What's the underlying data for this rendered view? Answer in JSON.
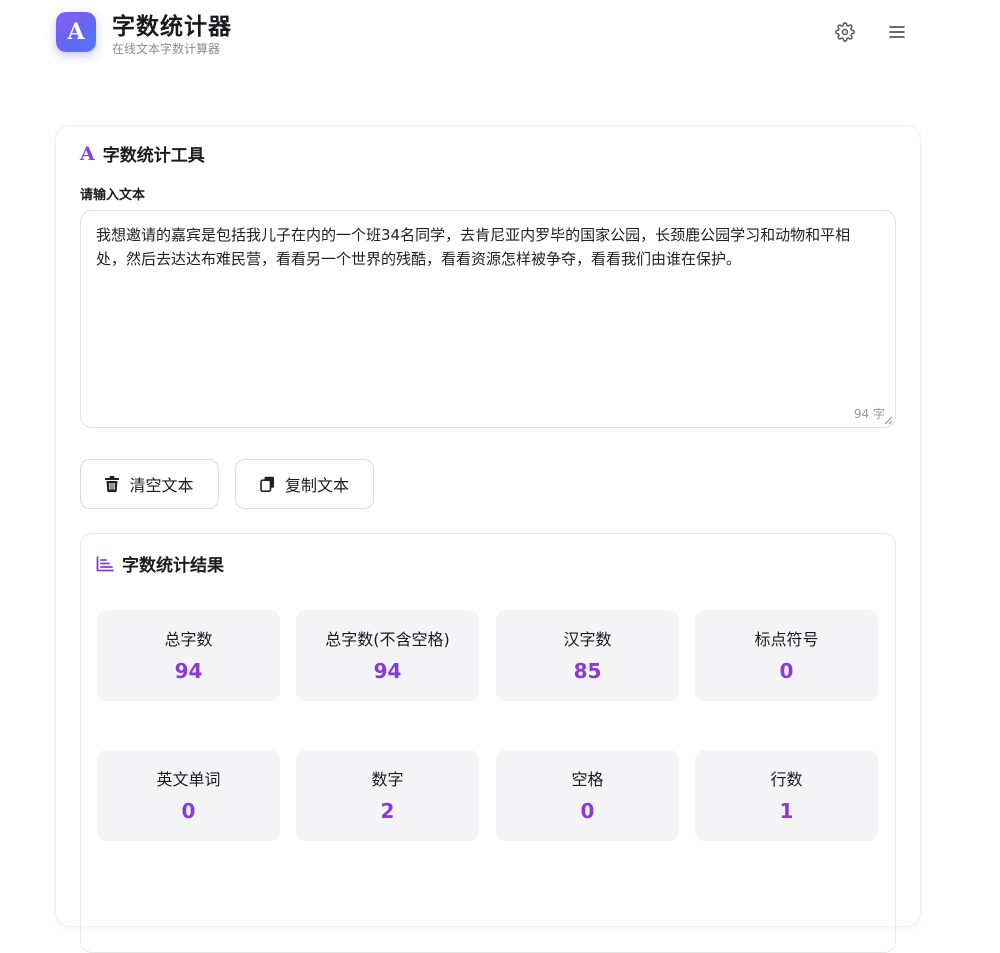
{
  "header": {
    "logo_letter": "A",
    "title": "字数统计器",
    "subtitle": "在线文本字数计算器",
    "settings_icon": "gear-icon",
    "menu_icon": "hamburger-menu-icon"
  },
  "tool": {
    "title": "字数统计工具",
    "title_icon": "letter-a-icon",
    "input_label": "请输入文本",
    "text_value": "我想邀请的嘉宾是包括我儿子在内的一个班34名同学，去肯尼亚内罗毕的国家公园，长颈鹿公园学习和动物和平相处，然后去达达布难民营，看看另一个世界的残酷，看看资源怎样被争夺，看看我们由谁在保护。",
    "char_count": "94 字",
    "clear_button": "清空文本",
    "copy_button": "复制文本"
  },
  "results": {
    "title": "字数统计结果",
    "title_icon": "bar-chart-icon",
    "stats": [
      {
        "label": "总字数",
        "value": "94"
      },
      {
        "label": "总字数(不含空格)",
        "value": "94"
      },
      {
        "label": "汉字数",
        "value": "85"
      },
      {
        "label": "标点符号",
        "value": "0"
      },
      {
        "label": "英文单词",
        "value": "0"
      },
      {
        "label": "数字",
        "value": "2"
      },
      {
        "label": "空格",
        "value": "0"
      },
      {
        "label": "行数",
        "value": "1"
      }
    ]
  },
  "colors": {
    "accent": "#8a3ad8",
    "logo_gradient_start": "#8b5cf6",
    "logo_gradient_end": "#4f7cf7",
    "stat_background": "#f4f4f6"
  }
}
